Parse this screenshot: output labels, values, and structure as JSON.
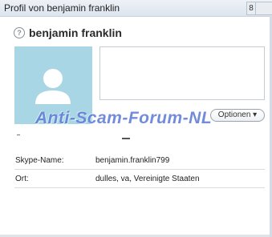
{
  "window": {
    "title": "Profil von benjamin franklin",
    "button_partial": "8"
  },
  "profile": {
    "display_name": "benjamin franklin",
    "status_icon": "question-status-icon",
    "avatar_icon": "default-user-avatar-icon",
    "options_label": "Optionen",
    "options_icon": "dropdown-arrow-icon"
  },
  "details": [
    {
      "label": "Skype-Name:",
      "value": "benjamin.franklin799"
    },
    {
      "label": "Ort:",
      "value": "dulles, va, Vereinigte Staaten"
    }
  ],
  "watermark": "Anti-Scam-Forum-NL",
  "colors": {
    "avatar_bg": "#a9d6e5",
    "watermark": "#3c5fcd"
  }
}
